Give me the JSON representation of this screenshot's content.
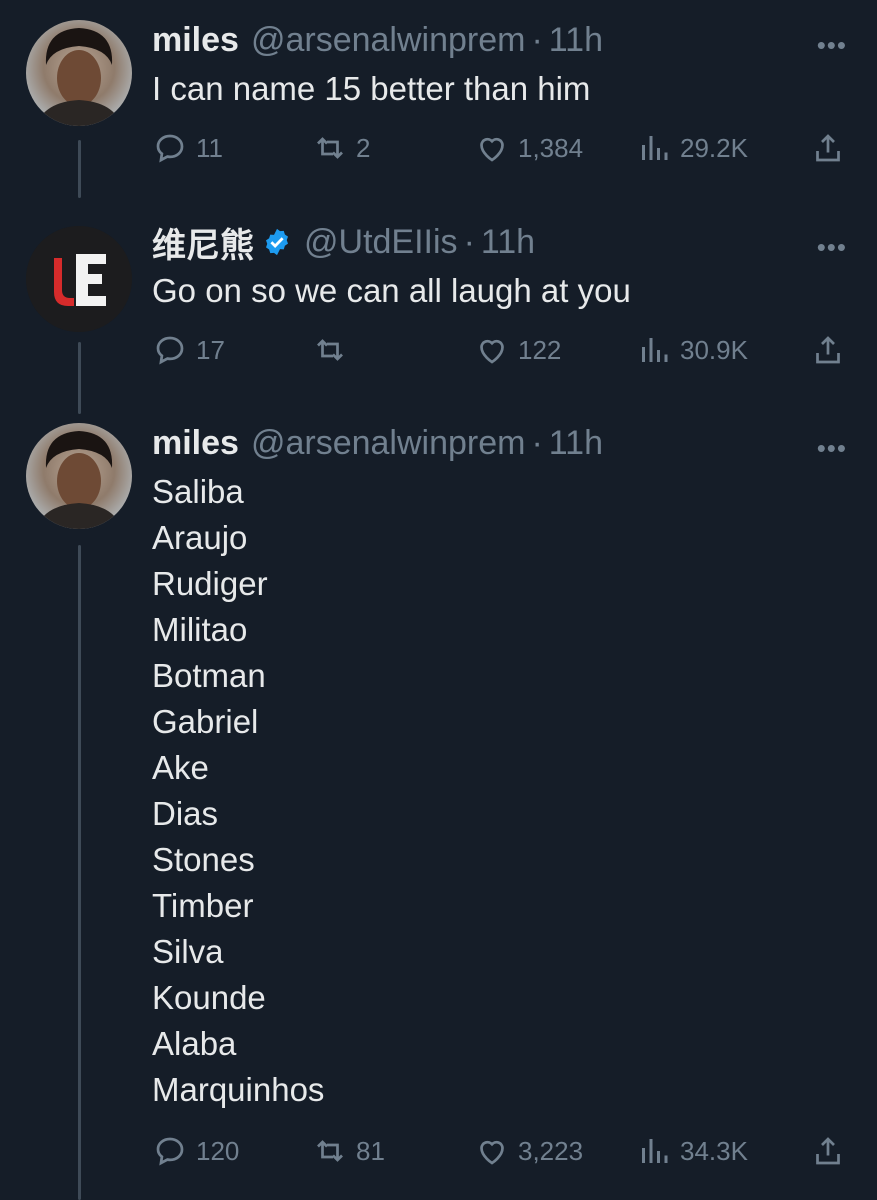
{
  "tweets": [
    {
      "name": "miles",
      "handle": "@arsenalwinprem",
      "time": "11h",
      "text": "I can name 15 better than him",
      "replies": "11",
      "retweets": "2",
      "likes": "1,384",
      "views": "29.2K",
      "verified": false
    },
    {
      "name": "维尼熊",
      "handle": "@UtdEIIis",
      "time": "11h",
      "text": "Go on so we can all laugh at you",
      "replies": "17",
      "retweets": "",
      "likes": "122",
      "views": "30.9K",
      "verified": true
    },
    {
      "name": "miles",
      "handle": "@arsenalwinprem",
      "time": "11h",
      "lines": [
        "Saliba",
        "Araujo",
        "Rudiger",
        "Militao",
        "Botman",
        "Gabriel",
        "Ake",
        "Dias",
        "Stones",
        "Timber",
        "Silva",
        "Kounde",
        "Alaba",
        "Marquinhos"
      ],
      "replies": "120",
      "retweets": "81",
      "likes": "3,223",
      "views": "34.3K",
      "verified": false
    }
  ],
  "ui": {
    "dot": "·",
    "more": "•••",
    "verified_color": "#1d9bf0",
    "logo_text_left": "U",
    "logo_text_right": "E"
  }
}
